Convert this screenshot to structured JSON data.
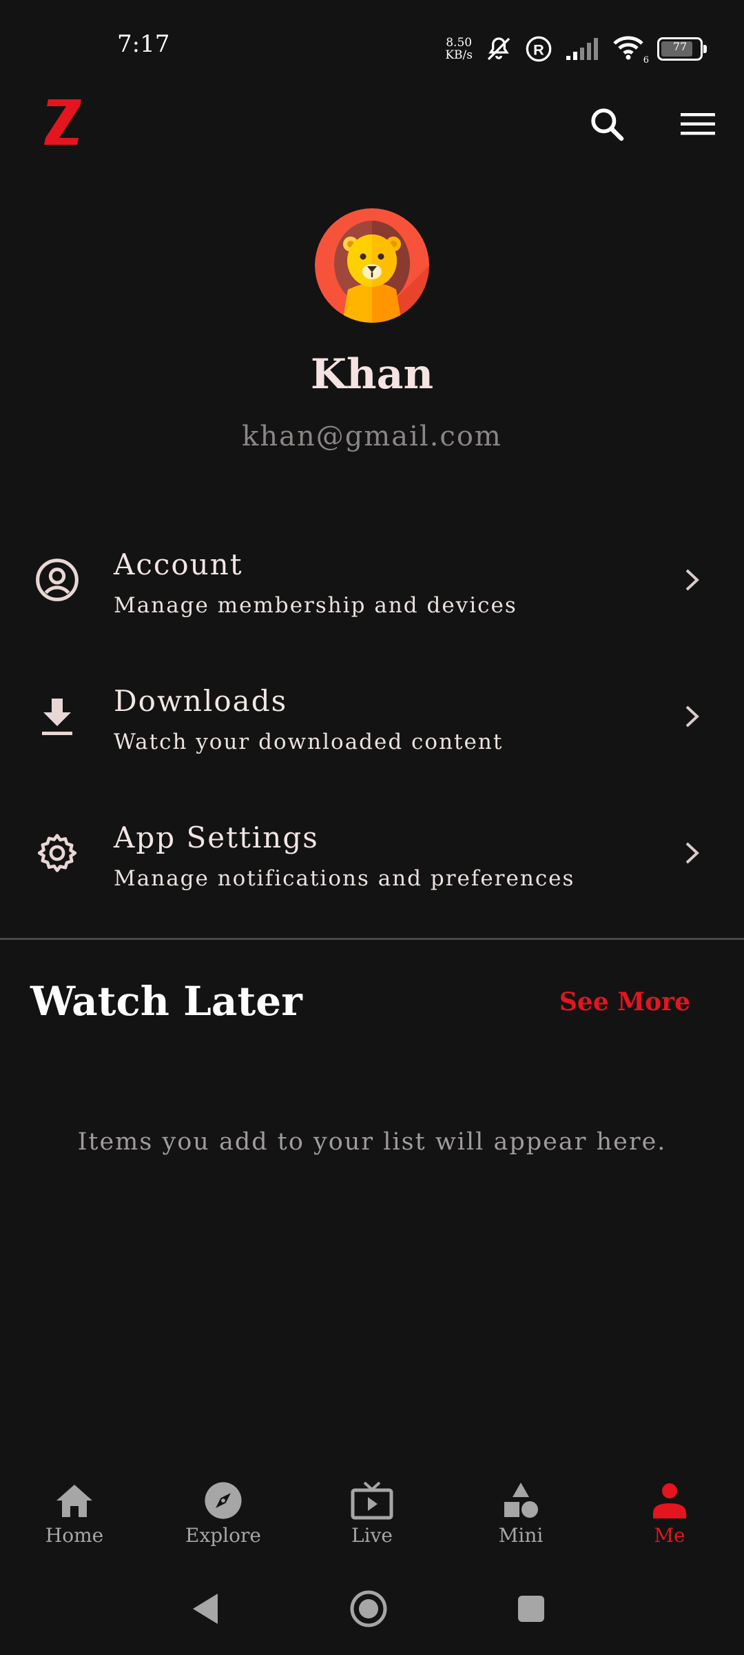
{
  "status_bar": {
    "time": "7:17",
    "net_speed_value": "8.50",
    "net_speed_unit": "KB/s",
    "wifi_badge": "6",
    "battery": "77"
  },
  "header": {
    "logo_letter": "Z",
    "accent_color": "#e4151f"
  },
  "profile": {
    "name": "Khan",
    "email": "khan@gmail.com"
  },
  "menu": [
    {
      "title": "Account",
      "subtitle": "Manage membership and devices",
      "icon": "account-circle-icon"
    },
    {
      "title": "Downloads",
      "subtitle": "Watch your downloaded content",
      "icon": "download-icon"
    },
    {
      "title": "App Settings",
      "subtitle": "Manage notifications and preferences",
      "icon": "gear-icon"
    }
  ],
  "watch_later": {
    "title": "Watch Later",
    "see_more": "See More",
    "empty_message": "Items you add to your list will appear here."
  },
  "bottom_nav": [
    {
      "label": "Home",
      "icon": "home-icon"
    },
    {
      "label": "Explore",
      "icon": "compass-icon"
    },
    {
      "label": "Live",
      "icon": "tv-icon"
    },
    {
      "label": "Mini",
      "icon": "shapes-icon"
    },
    {
      "label": "Me",
      "icon": "person-icon",
      "active": true
    }
  ]
}
